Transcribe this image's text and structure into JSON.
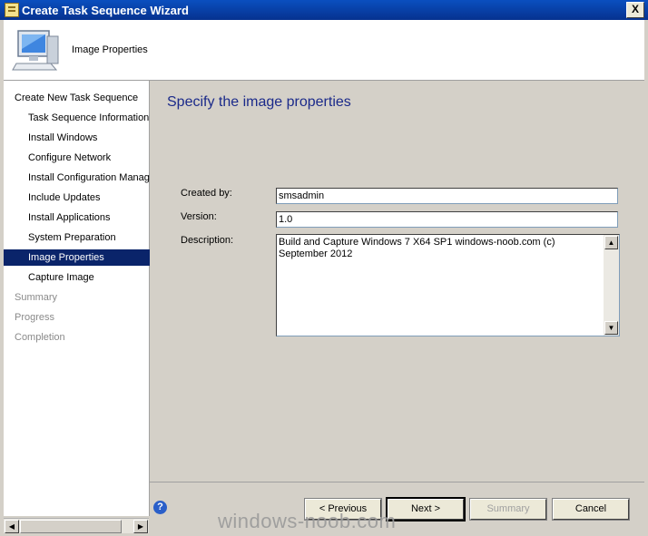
{
  "window": {
    "title": "Create Task Sequence Wizard",
    "close_glyph": "X"
  },
  "header": {
    "title": "Image Properties",
    "icon": "computer-icon"
  },
  "sidebar": {
    "items": [
      {
        "label": "Create New Task Sequence",
        "level": "top",
        "state": "normal"
      },
      {
        "label": "Task Sequence Information",
        "level": "sub",
        "state": "normal"
      },
      {
        "label": "Install Windows",
        "level": "sub",
        "state": "normal"
      },
      {
        "label": "Configure Network",
        "level": "sub",
        "state": "normal"
      },
      {
        "label": "Install Configuration Manag",
        "level": "sub",
        "state": "normal"
      },
      {
        "label": "Include Updates",
        "level": "sub",
        "state": "normal"
      },
      {
        "label": "Install Applications",
        "level": "sub",
        "state": "normal"
      },
      {
        "label": "System Preparation",
        "level": "sub",
        "state": "normal"
      },
      {
        "label": "Image Properties",
        "level": "sub",
        "state": "selected"
      },
      {
        "label": "Capture Image",
        "level": "sub",
        "state": "normal"
      },
      {
        "label": "Summary",
        "level": "top",
        "state": "disabled"
      },
      {
        "label": "Progress",
        "level": "top",
        "state": "disabled"
      },
      {
        "label": "Completion",
        "level": "top",
        "state": "disabled"
      }
    ]
  },
  "main": {
    "heading": "Specify the image properties",
    "created_by_label": "Created by:",
    "created_by_value": "smsadmin",
    "version_label": "Version:",
    "version_value": "1.0",
    "description_label": "Description:",
    "description_value": "Build and Capture Windows 7 X64 SP1 windows-noob.com (c) September 2012"
  },
  "footer": {
    "help_glyph": "?",
    "previous": "< Previous",
    "next": "Next >",
    "summary": "Summary",
    "cancel": "Cancel"
  },
  "watermark": "windows-noob.com",
  "colors": {
    "title_bar": "#0a4fbf",
    "selection": "#0a246a",
    "heading": "#1b2a8a",
    "dialog_bg": "#d4d0c8"
  }
}
